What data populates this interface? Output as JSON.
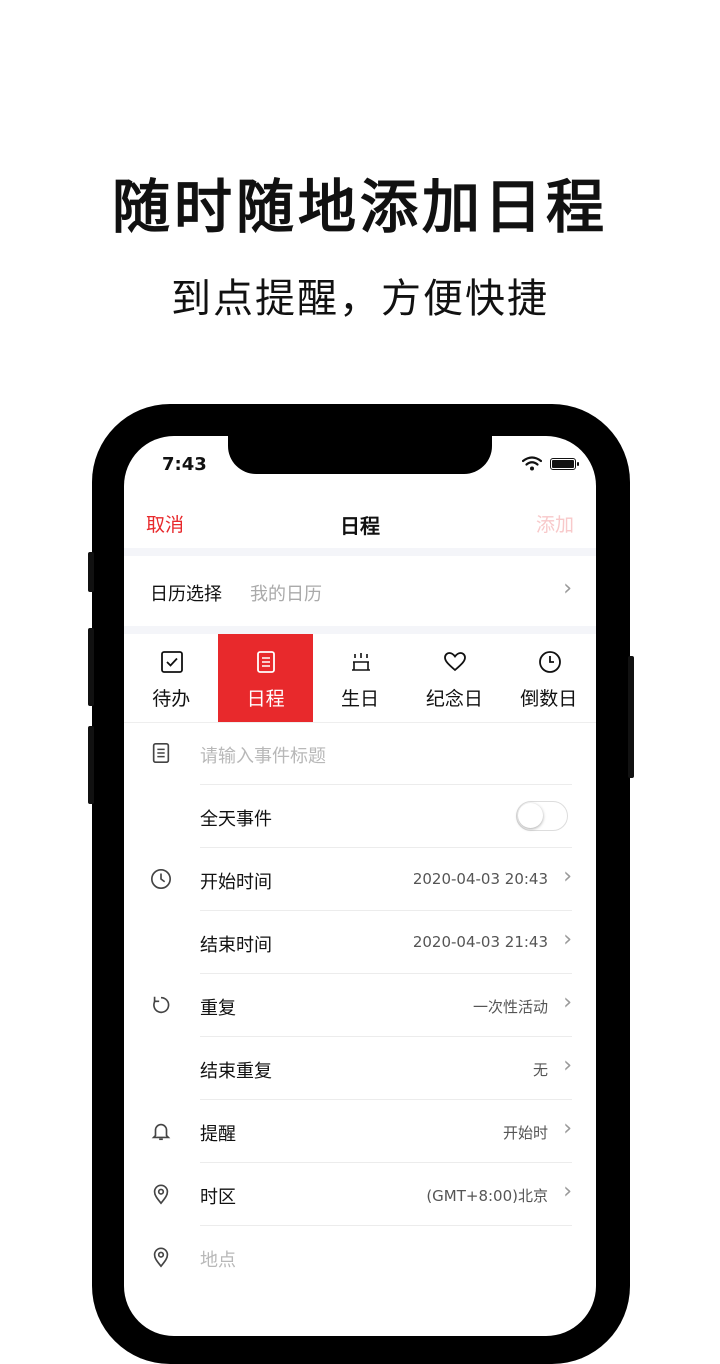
{
  "promo": {
    "headline": "随时随地添加日程",
    "subline": "到点提醒，方便快捷"
  },
  "status_bar": {
    "time": "7:43"
  },
  "navbar": {
    "cancel": "取消",
    "title": "日程",
    "add": "添加"
  },
  "calendar_select": {
    "label": "日历选择",
    "value": "我的日历"
  },
  "tabs": [
    {
      "label": "待办",
      "icon": "checkbox-icon",
      "active": false
    },
    {
      "label": "日程",
      "icon": "document-icon",
      "active": true
    },
    {
      "label": "生日",
      "icon": "cake-icon",
      "active": false
    },
    {
      "label": "纪念日",
      "icon": "heart-icon",
      "active": false
    },
    {
      "label": "倒数日",
      "icon": "clock-icon",
      "active": false
    }
  ],
  "form": {
    "title_placeholder": "请输入事件标题",
    "all_day": {
      "label": "全天事件",
      "on": false
    },
    "start": {
      "label": "开始时间",
      "value": "2020-04-03 20:43"
    },
    "end": {
      "label": "结束时间",
      "value": "2020-04-03 21:43"
    },
    "repeat": {
      "label": "重复",
      "value": "一次性活动"
    },
    "repeat_end": {
      "label": "结束重复",
      "value": "无"
    },
    "reminder": {
      "label": "提醒",
      "value": "开始时"
    },
    "timezone": {
      "label": "时区",
      "value": "(GMT+8:00)北京"
    },
    "location_placeholder": "地点"
  },
  "colors": {
    "accent": "#e8292c",
    "add_disabled": "#f8c9ca",
    "separator_bg": "#f4f5f9"
  }
}
